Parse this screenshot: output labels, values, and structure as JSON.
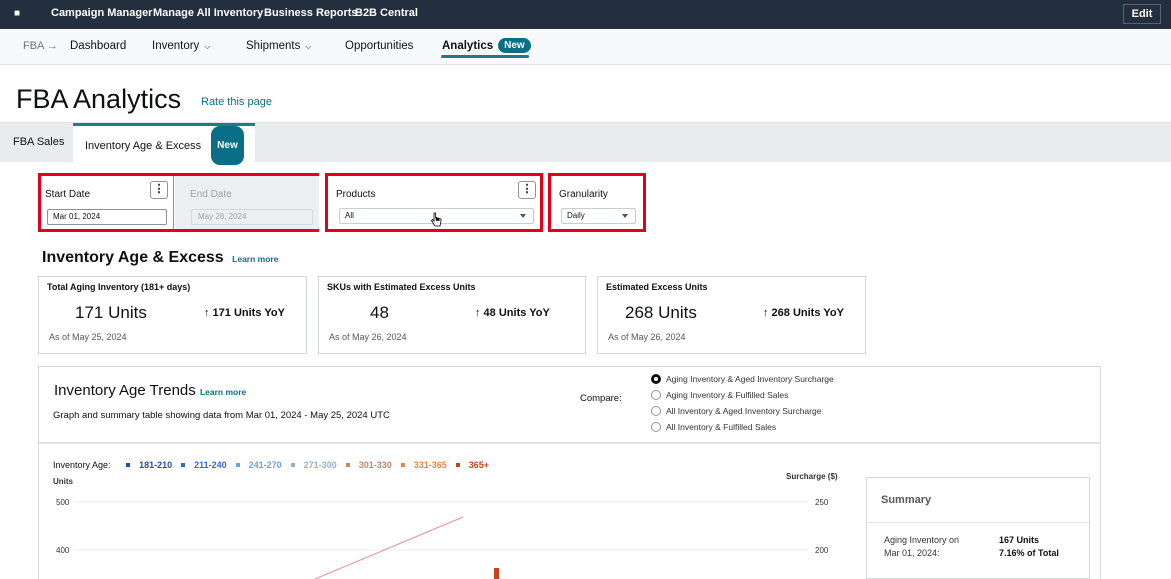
{
  "topbar": {
    "links": [
      "Campaign Manager",
      "Manage All Inventory",
      "Business Reports",
      "B2B Central"
    ],
    "edit_label": "Edit"
  },
  "nav": {
    "root": "FBA",
    "arrow": "→",
    "dashboard": "Dashboard",
    "inventory": "Inventory",
    "shipments": "Shipments",
    "opportunities": "Opportunities",
    "analytics": "Analytics",
    "new_badge": "New"
  },
  "page": {
    "title": "FBA Analytics",
    "rate_link": "Rate this page"
  },
  "tabs": {
    "sales": "FBA Sales",
    "age_excess": "Inventory Age & Excess",
    "new_badge": "New"
  },
  "filters": {
    "start_label": "Start Date",
    "start_value": "Mar 01, 2024",
    "end_label": "End Date",
    "end_value": "May 28, 2024",
    "products_label": "Products",
    "products_value": "All",
    "granularity_label": "Granularity",
    "granularity_value": "Daily",
    "more_glyph": "⋮"
  },
  "section": {
    "title": "Inventory Age & Excess",
    "learn_more": "Learn more"
  },
  "cards": [
    {
      "title": "Total Aging Inventory (181+ days)",
      "value": "171 Units",
      "yoy": "↑ 171 Units YoY",
      "date": "As of May 25, 2024"
    },
    {
      "title": "SKUs with Estimated Excess Units",
      "value": "48",
      "yoy": "↑ 48 Units YoY",
      "date": "As of May 26, 2024"
    },
    {
      "title": "Estimated Excess Units",
      "value": "268 Units",
      "yoy": "↑ 268 Units YoY",
      "date": "As of May 26, 2024"
    }
  ],
  "trends": {
    "title": "Inventory Age Trends",
    "learn_more": "Learn more",
    "subtitle": "Graph and summary table showing data from Mar 01, 2024 - May 25, 2024 UTC",
    "compare_label": "Compare:",
    "options": [
      {
        "label": "Aging Inventory & Aged Inventory Surcharge",
        "selected": true
      },
      {
        "label": "Aging Inventory & Fulfilled Sales",
        "selected": false
      },
      {
        "label": "All Inventory & Aged Inventory Surcharge",
        "selected": false
      },
      {
        "label": "All Inventory & Fulfilled Sales",
        "selected": false
      }
    ]
  },
  "chart": {
    "legend_label": "Inventory Age:",
    "legend": [
      {
        "name": "181-210",
        "color": "#1f4e9c"
      },
      {
        "name": "211-240",
        "color": "#2e6fc4"
      },
      {
        "name": "241-270",
        "color": "#6aa4dc"
      },
      {
        "name": "271-300",
        "color": "#8fb3cf"
      },
      {
        "name": "301-330",
        "color": "#c0876a"
      },
      {
        "name": "331-365",
        "color": "#e08a4a"
      },
      {
        "name": "365+",
        "color": "#c8411b"
      }
    ],
    "y_left_label": "Units",
    "y_right_label": "Surcharge ($)",
    "y_left_ticks": [
      "500",
      "400"
    ],
    "y_right_ticks": [
      "250",
      "200"
    ]
  },
  "chart_data": {
    "type": "bar",
    "ylim": [
      0,
      500
    ],
    "y2lim": [
      0,
      250
    ],
    "ylabel": "Units",
    "y2label": "Surcharge ($)",
    "series_names": [
      "181-210",
      "211-240",
      "241-270",
      "271-300",
      "301-330",
      "331-365",
      "365+"
    ],
    "legend_position": "top-left"
  },
  "summary": {
    "title": "Summary",
    "row_label_1": "Aging Inventory on",
    "row_label_2": "Mar 01, 2024:",
    "row_value_1": "167 Units",
    "row_value_2": "7.16% of Total"
  }
}
